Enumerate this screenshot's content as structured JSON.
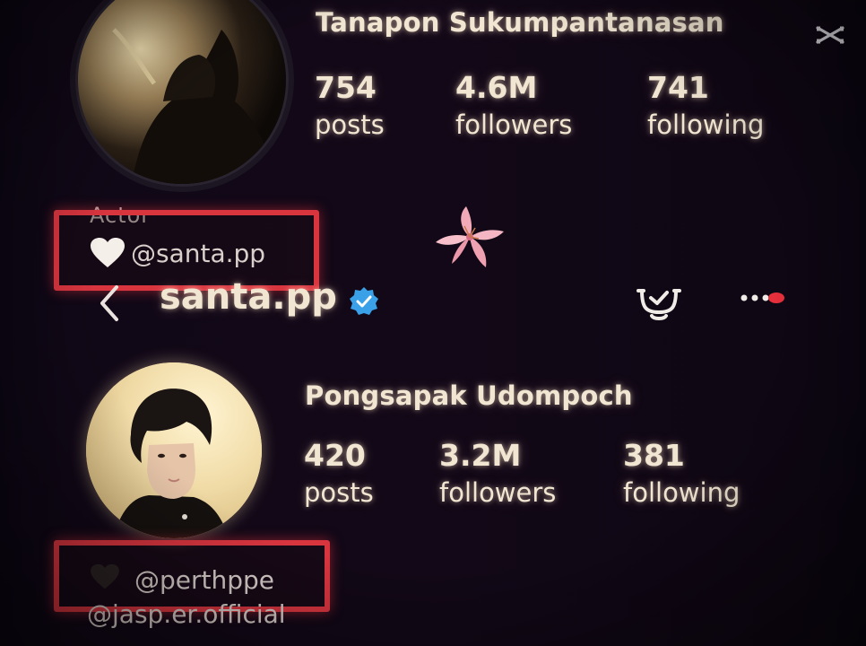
{
  "overlay": {
    "watermark_icon": "capcut-logo-icon"
  },
  "profile_top": {
    "name": "Tanapon Sukumpantanasan",
    "stats": [
      {
        "value": "754",
        "label": "posts"
      },
      {
        "value": "4.6M",
        "label": "followers"
      },
      {
        "value": "741",
        "label": "following"
      }
    ],
    "bio_category": "Actor",
    "bio_handle": "@santa.pp",
    "bio_heart_icon": "white-heart-icon"
  },
  "header": {
    "back_icon": "back-chevron-icon",
    "username": "santa.pp",
    "verified_icon": "verified-badge-icon",
    "notifications_icon": "bell-check-icon",
    "more_icon": "more-dots-icon"
  },
  "decoration": {
    "sticker_icon": "lily-flower-icon"
  },
  "profile_bottom": {
    "name": "Pongsapak Udompoch",
    "stats": [
      {
        "value": "420",
        "label": "posts"
      },
      {
        "value": "3.2M",
        "label": "followers"
      },
      {
        "value": "381",
        "label": "following"
      }
    ],
    "bio_handle": "@perthppe",
    "bio_heart_icon": "black-heart-icon",
    "link_handle": "@jasp.er.official"
  },
  "colors": {
    "highlight_box": "#d8353f",
    "verified": "#3aa0e8",
    "notification_dot": "#e8303c",
    "text_glow": "#f1e6d2"
  }
}
